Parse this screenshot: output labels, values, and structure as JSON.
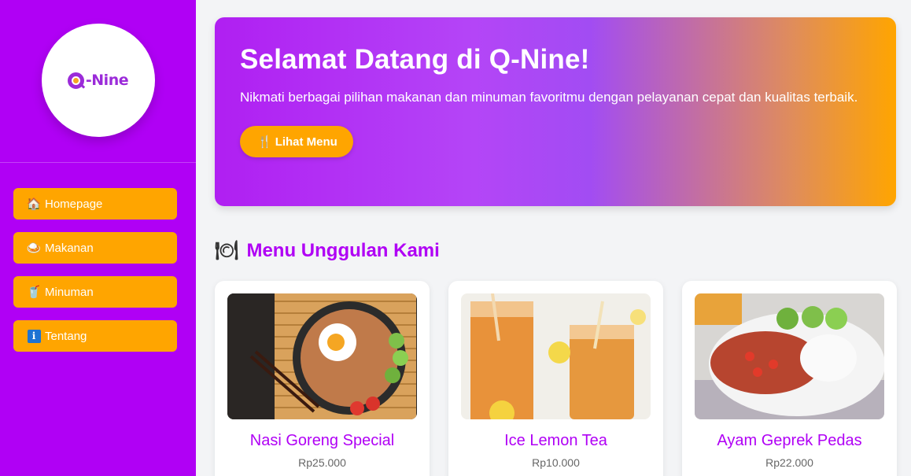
{
  "brand": {
    "logo_text": "-Nine"
  },
  "sidebar": {
    "items": [
      {
        "icon": "🏠",
        "label": "Homepage"
      },
      {
        "icon": "🍛",
        "label": "Makanan"
      },
      {
        "icon": "🥤",
        "label": "Minuman"
      },
      {
        "icon": "i",
        "label": "Tentang"
      }
    ]
  },
  "hero": {
    "title": "Selamat Datang di Q-Nine!",
    "description": "Nikmati berbagai pilihan makanan dan minuman favoritmu dengan pelayanan cepat dan kualitas terbaik.",
    "button_icon": "🍴",
    "button_label": "Lihat Menu"
  },
  "section": {
    "icon": "🍽",
    "title": "Menu Unggulan Kami"
  },
  "menu": [
    {
      "name": "Nasi Goreng Special",
      "price": "Rp25.000"
    },
    {
      "name": "Ice Lemon Tea",
      "price": "Rp10.000"
    },
    {
      "name": "Ayam Geprek Pedas",
      "price": "Rp22.000"
    }
  ],
  "colors": {
    "sidebar": "#b000f5",
    "accent": "#ffa500",
    "brand_text": "#9b2bd9"
  }
}
